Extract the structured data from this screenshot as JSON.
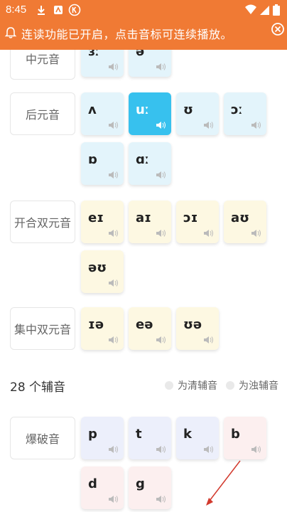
{
  "status": {
    "time": "8:45"
  },
  "banner": {
    "text": "连读功能已开启，点击音标可连续播放。"
  },
  "groups": [
    {
      "label": "中元音",
      "symbols": [
        "ɜː",
        "ə"
      ]
    },
    {
      "label": "后元音",
      "symbols": [
        "ʌ",
        "uː",
        "ʊ",
        "ɔː",
        "ɒ",
        "ɑː"
      ]
    },
    {
      "label": "开合双元音",
      "symbols": [
        "eɪ",
        "aɪ",
        "ɔɪ",
        "aʊ",
        "əʊ"
      ]
    },
    {
      "label": "集中双元音",
      "symbols": [
        "ɪə",
        "eə",
        "ʊə"
      ]
    },
    {
      "label": "爆破音",
      "symbols": [
        "p",
        "t",
        "k",
        "b",
        "d",
        "g"
      ]
    }
  ],
  "consonants": {
    "title": "28 个辅音",
    "legend_voiceless": "为清辅音",
    "legend_voiced": "为浊辅音"
  },
  "colors": {
    "header": "#f07a34",
    "active_tile": "#37c1ee",
    "blue_tile": "#e3f4fb",
    "yellow_tile": "#fdf8e2",
    "voiceless_tile": "#eceffb",
    "voiced_tile": "#fcefef"
  }
}
